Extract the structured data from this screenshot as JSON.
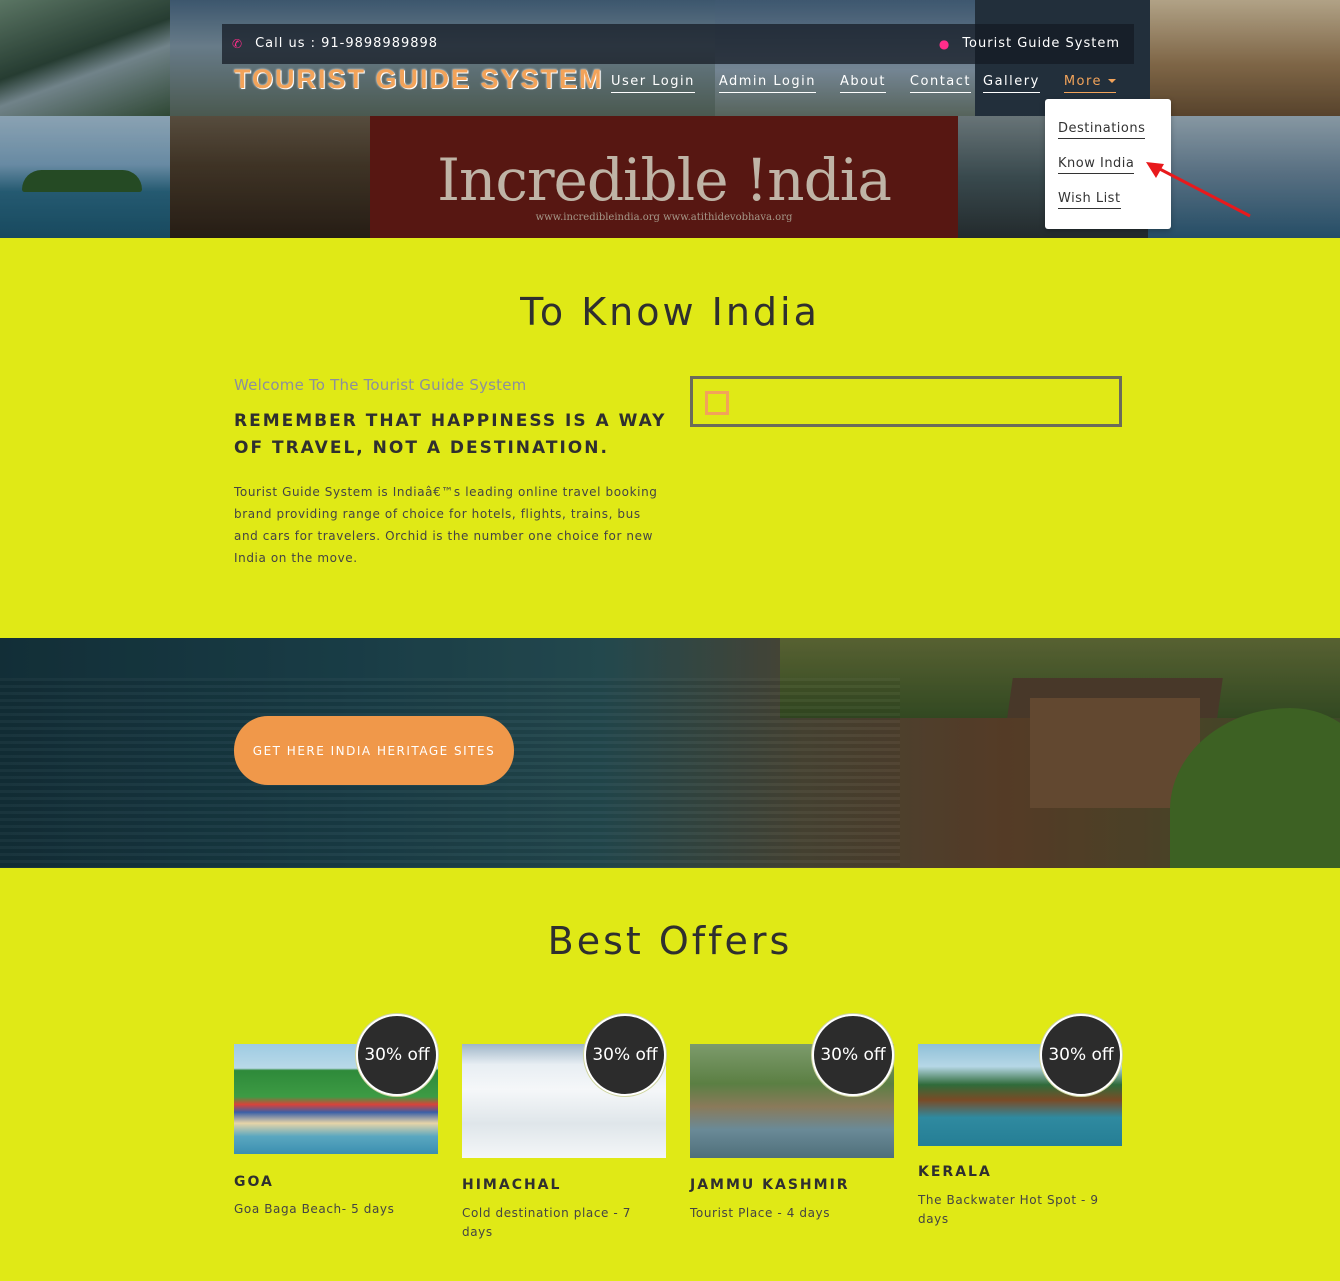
{
  "topbar": {
    "phone_icon": "phone-icon",
    "phone_text": "Call us : 91-9898989898",
    "pin_icon": "map-pin-icon",
    "site_text": "Tourist Guide System"
  },
  "header": {
    "brand": "TOURIST GUIDE SYSTEM",
    "hero_banner_text": "Incredible !ndia",
    "hero_banner_sub": "www.incredibleindia.org   www.atithidevobhava.org",
    "nav": [
      "User Login",
      "Admin Login",
      "About",
      "Contact",
      "Gallery",
      "More"
    ],
    "dropdown": [
      "Destinations",
      "Know India",
      "Wish List"
    ]
  },
  "about": {
    "title": "To Know India",
    "welcome": "Welcome To The Tourist Guide System",
    "quote": "REMEMBER THAT HAPPINESS IS A WAY OF TRAVEL, NOT A DESTINATION.",
    "description": "Tourist Guide System is Indiaâ€™s leading online travel booking brand providing range of choice for hotels, flights, trains, bus and cars for travelers. Orchid is the number one choice for new India on the move."
  },
  "banner": {
    "button_label": "GET HERE INDIA HERITAGE SITES"
  },
  "offers": {
    "title": "Best Offers",
    "cards": [
      {
        "badge": "30% off",
        "name": "GOA",
        "info": "Goa Baga Beach- 5 days"
      },
      {
        "badge": "30% off",
        "name": "HIMACHAL",
        "info": "Cold destination place - 7 days"
      },
      {
        "badge": "30% off",
        "name": "JAMMU KASHMIR",
        "info": "Tourist Place - 4 days"
      },
      {
        "badge": "30% off",
        "name": "KERALA",
        "info": "The Backwater Hot Spot - 9 days"
      }
    ]
  },
  "colors": {
    "page_bg": "#e0e916",
    "accent_orange": "#f0984a",
    "badge_bg": "#2c2c2c",
    "pink_icon": "#ff2d8a",
    "annotation_arrow": "#e8191c"
  }
}
